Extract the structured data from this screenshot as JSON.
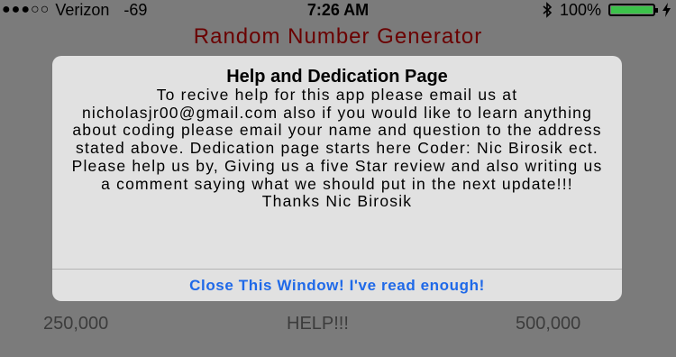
{
  "status_bar": {
    "carrier": "Verizon",
    "signal_dots": "●●●○○",
    "signal_strength": "-69",
    "time": "7:26 AM",
    "bluetooth_icon": "bluetooth-icon",
    "battery_percent": "100%",
    "battery_level": 1.0,
    "charging_icon": "bolt-icon",
    "battery_color": "#3cc24a"
  },
  "app": {
    "title": "Random Number Generator",
    "title_color": "#6a0000",
    "bottom_buttons": [
      "250,000",
      "HELP!!!",
      "500,000"
    ]
  },
  "alert": {
    "title": "Help and Dedication Page",
    "message": "To recive help for this app please email us at nicholasjr00@gmail.com also if you would like to learn anything about coding please email your name and question to the address stated above. Dedication page starts here Coder: Nic Birosik ect. Please help us by, Giving us a five Star review and also writing us a comment saying what we should put in the next update!!! Thanks Nic Birosik",
    "button_label": "Close This Window! I've read enough!",
    "button_color": "#1f69e8"
  }
}
